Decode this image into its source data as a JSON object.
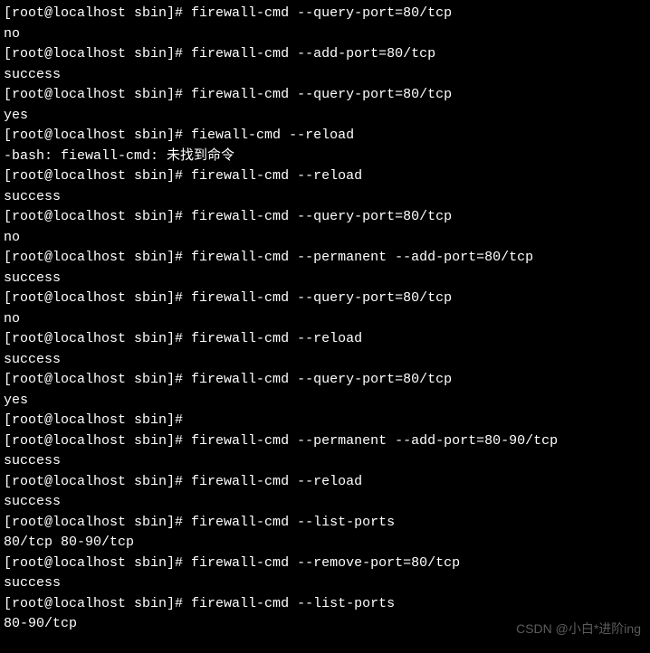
{
  "terminal": {
    "prompt": "[root@localhost sbin]# ",
    "entries": [
      {
        "cmd": "firewall-cmd --query-port=80/tcp",
        "out": "no"
      },
      {
        "cmd": "firewall-cmd --add-port=80/tcp",
        "out": "success"
      },
      {
        "cmd": "firewall-cmd --query-port=80/tcp",
        "out": "yes"
      },
      {
        "cmd": "fiewall-cmd --reload",
        "out": "-bash: fiewall-cmd: 未找到命令"
      },
      {
        "cmd": "firewall-cmd --reload",
        "out": "success"
      },
      {
        "cmd": "firewall-cmd --query-port=80/tcp",
        "out": "no"
      },
      {
        "cmd": "firewall-cmd --permanent --add-port=80/tcp",
        "out": "success"
      },
      {
        "cmd": "firewall-cmd --query-port=80/tcp",
        "out": "no"
      },
      {
        "cmd": "firewall-cmd --reload",
        "out": "success"
      },
      {
        "cmd": "firewall-cmd --query-port=80/tcp",
        "out": "yes"
      },
      {
        "cmd": "",
        "out": ""
      },
      {
        "cmd": "firewall-cmd --permanent --add-port=80-90/tcp",
        "out": "success"
      },
      {
        "cmd": "firewall-cmd --reload",
        "out": "success"
      },
      {
        "cmd": "firewall-cmd --list-ports",
        "out": "80/tcp 80-90/tcp"
      },
      {
        "cmd": "firewall-cmd --remove-port=80/tcp",
        "out": "success"
      },
      {
        "cmd": "firewall-cmd --list-ports",
        "out": "80-90/tcp"
      }
    ]
  },
  "watermark": "CSDN @小白*进阶ing"
}
